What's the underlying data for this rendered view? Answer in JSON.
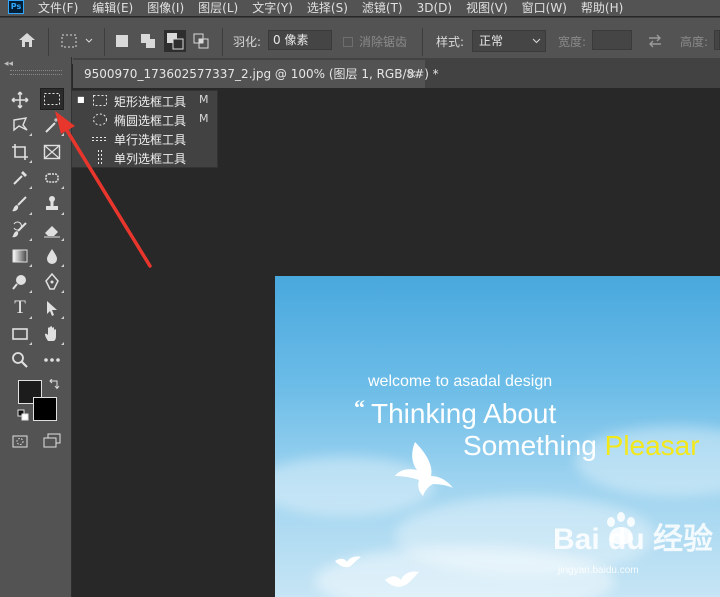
{
  "menu": {
    "logo": "Ps",
    "items": [
      "文件(F)",
      "编辑(E)",
      "图像(I)",
      "图层(L)",
      "文字(Y)",
      "选择(S)",
      "滤镜(T)",
      "3D(D)",
      "视图(V)",
      "窗口(W)",
      "帮助(H)"
    ]
  },
  "options": {
    "feather_label": "羽化:",
    "feather_value": "0 像素",
    "antialias_label": "消除锯齿",
    "style_label": "样式:",
    "style_value": "正常",
    "width_label": "宽度:",
    "height_label": "高度:"
  },
  "tab": {
    "title": "9500970_173602577337_2.jpg @ 100% (图层 1, RGB/8#) *",
    "close": "×"
  },
  "toolbar": {
    "collapse": "◂◂",
    "text_tool_glyph": "T"
  },
  "flyout": {
    "items": [
      {
        "label": "矩形选框工具",
        "shortcut": "M",
        "selected": true
      },
      {
        "label": "椭圆选框工具",
        "shortcut": "M",
        "selected": false
      },
      {
        "label": "单行选框工具",
        "shortcut": "",
        "selected": false
      },
      {
        "label": "单列选框工具",
        "shortcut": "",
        "selected": false
      }
    ],
    "bullet": "■"
  },
  "image": {
    "welcome": "welcome to asadal design",
    "quote_mark": "“",
    "line1": "Thinking About",
    "line2_prefix": "Something ",
    "line2_highlight": "Pleasar",
    "watermark": "Bai du 经验",
    "watermark_url": "jingyan.baidu.com"
  },
  "colors": {
    "ui_panel": "#535353",
    "canvas_bg": "#282828",
    "arrow": "#e8362c",
    "sky_top": "#49a8dd",
    "highlight_text": "#f3e81a"
  }
}
